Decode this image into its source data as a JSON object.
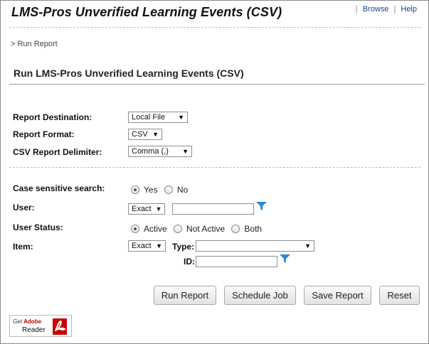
{
  "header": {
    "title": "LMS-Pros Unverified Learning Events (CSV)",
    "links": [
      "Browse",
      "Help"
    ]
  },
  "breadcrumb": "> Run Report",
  "page_title": "Run LMS-Pros Unverified Learning Events (CSV)",
  "report": {
    "destination_label": "Report Destination:",
    "destination_value": "Local File",
    "format_label": "Report Format:",
    "format_value": "CSV",
    "delimiter_label": "CSV Report Delimiter:",
    "delimiter_value": "Comma (,)"
  },
  "filters": {
    "case_label": "Case sensitive search:",
    "case_options": [
      "Yes",
      "No"
    ],
    "case_selected": "Yes",
    "user_label": "User:",
    "user_match": "Exact",
    "user_value": "",
    "status_label": "User Status:",
    "status_options": [
      "Active",
      "Not Active",
      "Both"
    ],
    "status_selected": "Active",
    "item_label": "Item:",
    "item_match": "Exact",
    "type_label": "Type:",
    "type_value": "",
    "id_label": "ID:",
    "id_value": ""
  },
  "actions": {
    "run": "Run Report",
    "schedule": "Schedule Job",
    "save": "Save Report",
    "reset": "Reset"
  },
  "adobe_badge": {
    "line1_prefix": "Get",
    "line1_brand": "Adobe",
    "line2": "Reader"
  },
  "colors": {
    "link": "#1a3d8f",
    "funnel": "#2a8ad8",
    "adobe_red": "#cc0000"
  }
}
